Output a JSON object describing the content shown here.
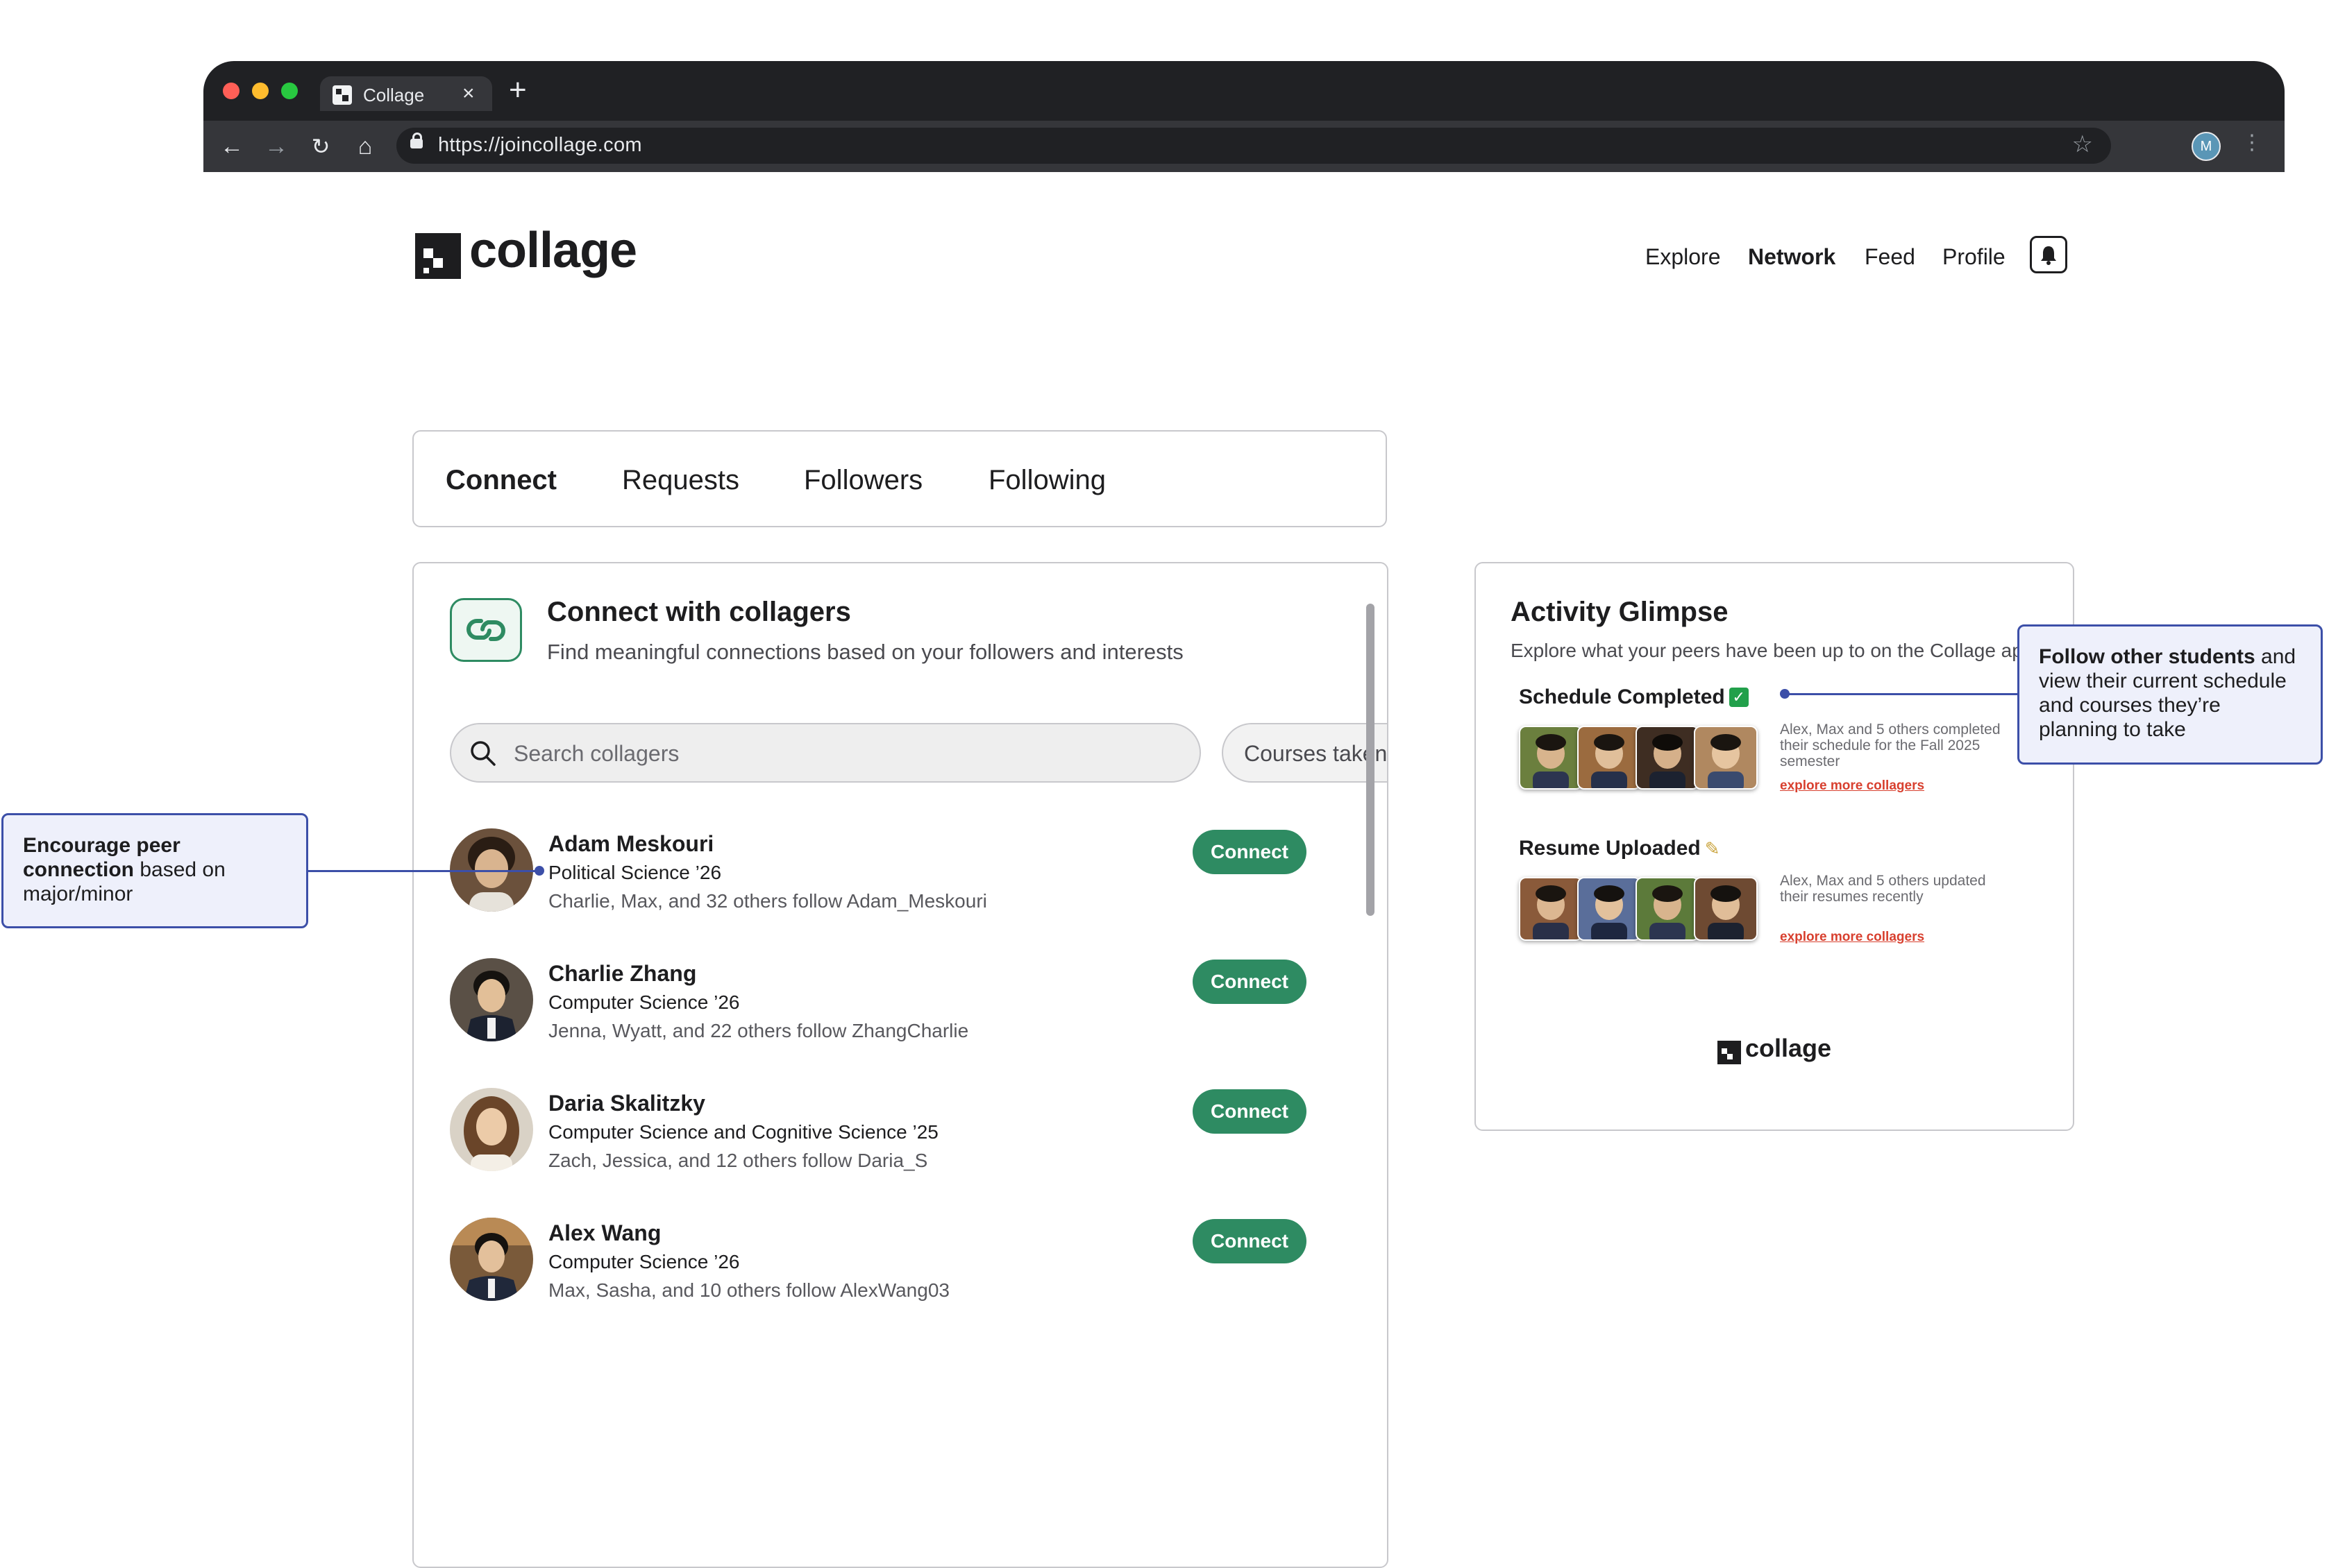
{
  "browser": {
    "tab_title": "Collage",
    "url": "https://joincollage.com",
    "profile_initial": "M",
    "traffic_lights": [
      "#ff5f57",
      "#febc2e",
      "#28c840"
    ]
  },
  "header": {
    "logo_text": "collage",
    "nav": [
      "Explore",
      "Network",
      "Feed",
      "Profile"
    ],
    "active_nav": "Network"
  },
  "tabs": {
    "items": [
      "Connect",
      "Requests",
      "Followers",
      "Following"
    ],
    "active": "Connect"
  },
  "connect_card": {
    "title": "Connect with collagers",
    "subtitle": "Find meaningful connections based on your followers and interests",
    "search_placeholder": "Search collagers",
    "filter_label": "Courses taken",
    "connect_label": "Connect",
    "people": [
      {
        "name": "Adam Meskouri",
        "major": "Political Science ’26",
        "followers": "Charlie, Max, and 32 others follow Adam_Meskouri",
        "avatar_color": "#8a6a4f"
      },
      {
        "name": "Charlie Zhang",
        "major": "Computer Science ’26",
        "followers": "Jenna, Wyatt, and 22 others follow ZhangCharlie",
        "avatar_color": "#3a3f4a"
      },
      {
        "name": "Daria Skalitzky",
        "major": "Computer Science and Cognitive Science ’25",
        "followers": "Zach, Jessica, and 12 others follow Daria_S",
        "avatar_color": "#9c7a5b"
      },
      {
        "name": "Alex Wang",
        "major": "Computer Science ’26",
        "followers": "Max, Sasha, and 10 others follow AlexWang03",
        "avatar_color": "#5a4634"
      }
    ],
    "accent_color": "#2e8b62"
  },
  "activity": {
    "title": "Activity Glimpse",
    "subtitle": "Explore what your peers have been up to on the Collage ap",
    "sections": [
      {
        "heading": "Schedule Completed",
        "badge": "✅",
        "text": "Alex, Max and 5 others completed their schedule for the Fall 2025 semester",
        "link": "explore more collagers"
      },
      {
        "heading": "Resume Uploaded",
        "badge": "📝",
        "text": "Alex, Max and 5 others updated their resumes recently",
        "link": "explore more collagers"
      }
    ],
    "footer_logo": "collage"
  },
  "callouts": {
    "left": {
      "bold1": "Encourage peer connection",
      "rest": " based on major/minor"
    },
    "right": {
      "bold1": "Follow other students",
      "rest": " and view their current schedule and courses they’re planning to take"
    }
  }
}
